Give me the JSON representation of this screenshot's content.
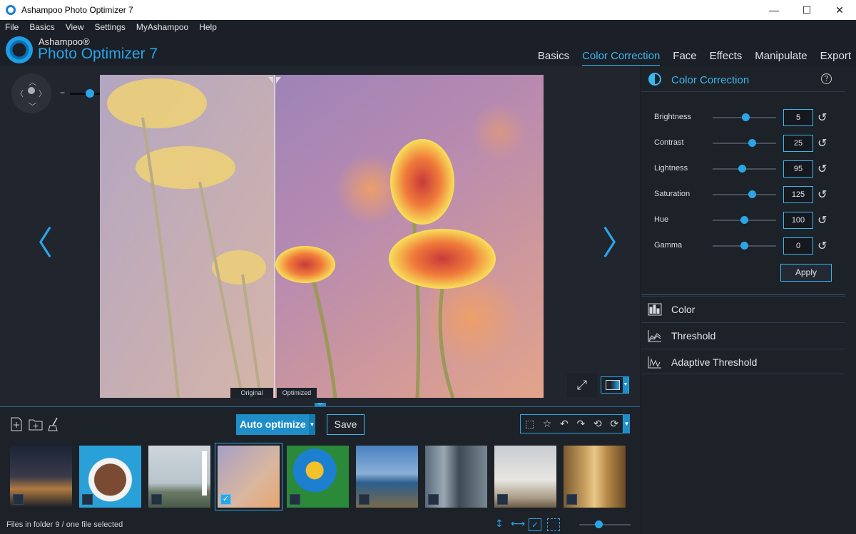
{
  "window": {
    "title": "Ashampoo Photo Optimizer 7",
    "minimize": "—",
    "maximize": "☐",
    "close": "✕"
  },
  "menu": [
    "File",
    "Basics",
    "View",
    "Settings",
    "MyAshampoo",
    "Help"
  ],
  "brand": {
    "line1": "Ashampoo®",
    "line2": "Photo Optimizer 7"
  },
  "tabs": [
    {
      "label": "Basics",
      "active": false
    },
    {
      "label": "Color Correction",
      "active": true
    },
    {
      "label": "Face",
      "active": false
    },
    {
      "label": "Effects",
      "active": false
    },
    {
      "label": "Manipulate",
      "active": false
    },
    {
      "label": "Export",
      "active": false
    }
  ],
  "viewer": {
    "zoom_minus": "−",
    "zoom_plus": "+",
    "label_original": "Original",
    "label_optimized": "Optimized",
    "prev": "〈",
    "next": "〉",
    "zoom_level": 0.3
  },
  "panel": {
    "title": "Color Correction",
    "help": "?",
    "sliders": [
      {
        "label": "Brightness",
        "value": "5",
        "level": 0.52
      },
      {
        "label": "Contrast",
        "value": "25",
        "level": 0.62
      },
      {
        "label": "Lightness",
        "value": "95",
        "level": 0.46
      },
      {
        "label": "Saturation",
        "value": "125",
        "level": 0.62
      },
      {
        "label": "Hue",
        "value": "100",
        "level": 0.49
      },
      {
        "label": "Gamma",
        "value": "0",
        "level": 0.49
      }
    ],
    "reset_glyph": "↺",
    "apply": "Apply",
    "sections": [
      "Color",
      "Threshold",
      "Adaptive Threshold"
    ]
  },
  "toolbar": {
    "auto_optimize": "Auto optimize",
    "save": "Save",
    "dropdown": "▼"
  },
  "thumbnails": [
    {
      "name": "city-night",
      "selected": false
    },
    {
      "name": "man-hat",
      "selected": false
    },
    {
      "name": "lighthouse",
      "selected": false
    },
    {
      "name": "flowers",
      "selected": true
    },
    {
      "name": "parrot",
      "selected": false
    },
    {
      "name": "golden-gate",
      "selected": false
    },
    {
      "name": "street",
      "selected": false
    },
    {
      "name": "taj-mahal",
      "selected": false
    },
    {
      "name": "forest-path",
      "selected": false
    }
  ],
  "status": {
    "text": "Files in folder 9 / one file selected",
    "thumb_zoom": 0.4
  },
  "colors": {
    "accent": "#2aa6e8",
    "bg": "#1b1f27",
    "panel": "#1d2128"
  }
}
